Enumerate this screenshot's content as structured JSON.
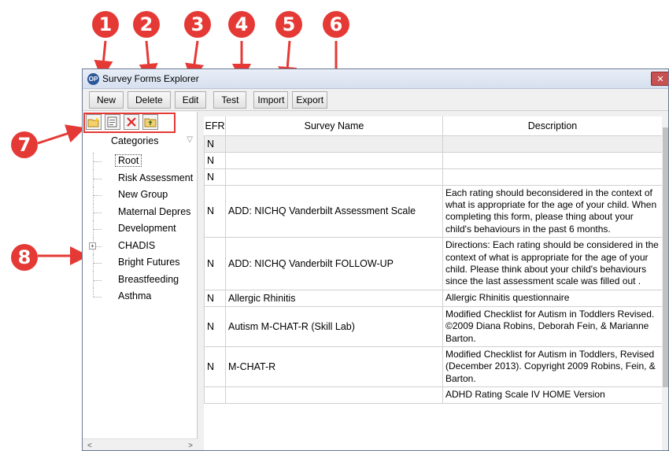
{
  "callouts": [
    "1",
    "2",
    "3",
    "4",
    "5",
    "6",
    "7",
    "8"
  ],
  "window": {
    "title": "Survey Forms Explorer",
    "app_icon": "OP",
    "close_icon": "✕"
  },
  "toolbar": {
    "new_label": "New",
    "delete_label": "Delete",
    "edit_label": "Edit",
    "test_label": "Test",
    "import_label": "Import",
    "export_label": "Export"
  },
  "mini_toolbar": {
    "icons": [
      "new-folder-icon",
      "properties-icon",
      "delete-x-icon",
      "move-up-icon"
    ]
  },
  "categories": {
    "header": "Categories",
    "items": [
      {
        "label": "Root",
        "selected": true
      },
      {
        "label": "Risk Assessment"
      },
      {
        "label": "New Group"
      },
      {
        "label": "Maternal Depres"
      },
      {
        "label": "Development"
      },
      {
        "label": "CHADIS",
        "expandable": true
      },
      {
        "label": "Bright Futures"
      },
      {
        "label": "Breastfeeding"
      },
      {
        "label": "Asthma"
      }
    ]
  },
  "grid": {
    "columns": {
      "efr": "EFR",
      "name": "Survey Name",
      "description": "Description"
    },
    "rows": [
      {
        "efr": "N",
        "name": "",
        "description": ""
      },
      {
        "efr": "N",
        "name": "",
        "description": ""
      },
      {
        "efr": "N",
        "name": "",
        "description": ""
      },
      {
        "efr": "N",
        "name": "ADD: NICHQ Vanderbilt Assessment Scale",
        "description": "Each rating should beconsidered in the context of what is appropriate for the age of your child.  When completing this form, please thing about your child's behaviours in the past 6 months."
      },
      {
        "efr": "N",
        "name": "ADD: NICHQ Vanderbilt FOLLOW-UP",
        "description": "Directions:  Each rating should be considered in the context of what is appropriate for the age of your child.  Please think about your child's behaviours since the last assessment scale was filled out ."
      },
      {
        "efr": "N",
        "name": "Allergic Rhinitis",
        "description": "Allergic Rhinitis questionnaire"
      },
      {
        "efr": "N",
        "name": "Autism M-CHAT-R (Skill Lab)",
        "description": "Modified Checklist for Autism in Toddlers Revised. ©2009 Diana Robins, Deborah Fein, & Marianne Barton."
      },
      {
        "efr": "N",
        "name": "M-CHAT-R",
        "description": "Modified Checklist for Autism in Toddlers, Revised (December 2013). Copyright 2009 Robins, Fein, & Barton."
      },
      {
        "efr": "",
        "name": "",
        "description": "ADHD Rating Scale IV HOME Version"
      }
    ]
  }
}
